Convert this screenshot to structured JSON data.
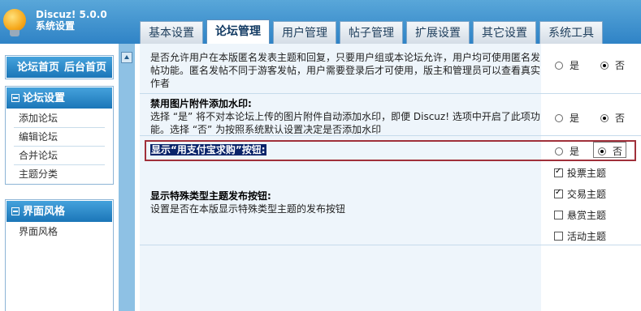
{
  "app": {
    "name": "Discuz! 5.0.0",
    "subtitle": "系统设置"
  },
  "tabs": [
    {
      "label": "基本设置",
      "active": false
    },
    {
      "label": "论坛管理",
      "active": true
    },
    {
      "label": "用户管理",
      "active": false
    },
    {
      "label": "帖子管理",
      "active": false
    },
    {
      "label": "扩展设置",
      "active": false
    },
    {
      "label": "其它设置",
      "active": false
    },
    {
      "label": "系统工具",
      "active": false
    }
  ],
  "sidebar": {
    "home_link": "论坛首页",
    "admin_home_link": "后台首页",
    "forum_settings": {
      "title": "论坛设置",
      "items": [
        "添加论坛",
        "编辑论坛",
        "合并论坛",
        "主题分类"
      ]
    },
    "ui_style": {
      "title": "界面风格",
      "items": [
        "界面风格"
      ]
    }
  },
  "settings": {
    "anonymous": {
      "desc": "是否允许用户在本版匿名发表主题和回复，只要用户组或本论坛允许，用户均可使用匿名发帖功能。匿名发帖不同于游客发帖，用户需要登录后才可使用，版主和管理员可以查看真实作者",
      "value": "no"
    },
    "watermark": {
      "title": "禁用图片附件添加水印:",
      "desc": "选择 “是” 将不对本论坛上传的图片附件自动添加水印，即便 Discuz! 选项中开启了此项功能。选择 “否” 为按照系统默认设置决定是否添加水印",
      "value": "no"
    },
    "alipay": {
      "title": "显示“用支付宝求购”按钮:",
      "value": "no"
    },
    "special_threads": {
      "title": "显示特殊类型主题发布按钮:",
      "desc": "设置是否在本版显示特殊类型主题的发布按钮",
      "options": [
        {
          "label": "投票主题",
          "checked": true
        },
        {
          "label": "交易主题",
          "checked": true
        },
        {
          "label": "悬赏主题",
          "checked": false
        },
        {
          "label": "活动主题",
          "checked": false
        }
      ]
    },
    "yes_label": "是",
    "no_label": "否"
  },
  "colors": {
    "header": "#2f83c6",
    "highlight": "#0a246a",
    "outline": "#a0303a"
  }
}
